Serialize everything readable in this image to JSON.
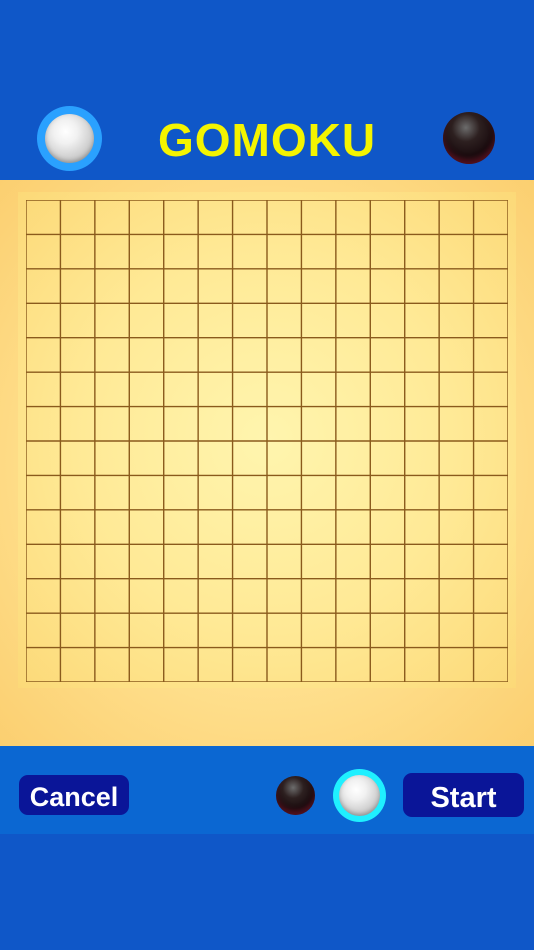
{
  "header": {
    "title": "GOMOKU",
    "player_left_stone": "white",
    "player_right_stone": "black",
    "active_indicator_color": "#2aa1ff"
  },
  "board": {
    "columns": 14,
    "rows": 14,
    "line_color": "#8a5a1c",
    "stones": []
  },
  "controls": {
    "cancel_label": "Cancel",
    "start_label": "Start",
    "stone_choices": [
      "black",
      "white"
    ],
    "selected_stone": "white",
    "selected_indicator_color": "#1ff0ff"
  },
  "colors": {
    "background": "#0f57c8",
    "bar": "#0b67d2",
    "button": "#0a1598",
    "title": "#f4f400"
  }
}
